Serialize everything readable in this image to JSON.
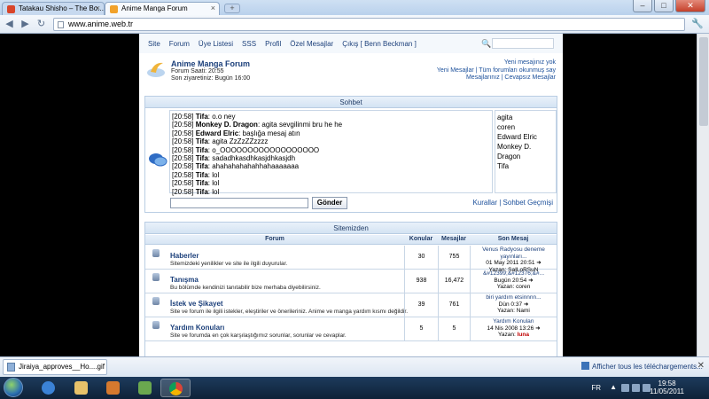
{
  "browser": {
    "tabs": [
      {
        "label": "Tatakau Shisho – The Bo..."
      },
      {
        "label": "Anime Manga Forum"
      }
    ],
    "url": "www.anime.web.tr"
  },
  "nav": {
    "items": [
      "Site",
      "Forum",
      "Üye Listesi",
      "SSS",
      "Profil",
      "Özel Mesajlar",
      "Çıkış [ Benn Beckman ]"
    ]
  },
  "header": {
    "site_name": "Anime Manga Forum",
    "time": "Forum Saati: 20:55",
    "last_visit": "Son ziyaretiniz: Bugün 16:00",
    "right_line1": "Yeni mesajınız yok",
    "right_line2": "Yeni Mesajlar | Tüm forumları okunmuş say",
    "right_line3": "Mesajlarınız | Cevapsız Mesajlar"
  },
  "chat": {
    "title": "Sohbet",
    "messages": [
      {
        "time": "[20:58]",
        "user": "Tifa",
        "text": ": o.o ney"
      },
      {
        "time": "[20:58]",
        "user": "Monkey D. Dragon",
        "text": ": agita sevgilinmi bru he he"
      },
      {
        "time": "[20:58]",
        "user": "Edward Elric",
        "text": ": başlığa mesaj atın"
      },
      {
        "time": "[20:58]",
        "user": "Tifa",
        "text": ": agita ZzZzZZzzzz"
      },
      {
        "time": "[20:58]",
        "user": "Tifa",
        "text": ": o_OOOOOOOOOOOOOOOOOO"
      },
      {
        "time": "[20:58]",
        "user": "Tifa",
        "text": ": sadadhkasdhkasjdhkasjdh"
      },
      {
        "time": "[20:58]",
        "user": "Tifa",
        "text": ": ahahahahahahhahaaaaaaa"
      },
      {
        "time": "[20:58]",
        "user": "Tifa",
        "text": ": lol"
      },
      {
        "time": "[20:58]",
        "user": "Tifa",
        "text": ": lol"
      },
      {
        "time": "[20:58]",
        "user": "Tifa",
        "text": ": lol"
      }
    ],
    "users": [
      "agita",
      "coren",
      "Edward Elric",
      "Monkey D. Dragon",
      "Tifa"
    ],
    "send_label": "Gönder",
    "links": "Kurallar | Sohbet Geçmişi"
  },
  "forums": {
    "title": "Sitemizden",
    "columns": {
      "forum": "Forum",
      "topics": "Konular",
      "posts": "Mesajlar",
      "last": "Son Mesaj"
    },
    "rows": [
      {
        "name": "Haberler",
        "desc": "Sitemizdeki yenilikler ve site ile ilgili duyurular.",
        "topics": "30",
        "posts": "755",
        "last_title": "Venus Radyosu deneme yayınları...",
        "last_date": "01 May 2011 20:51",
        "last_author_label": "Yazan:",
        "last_author": "SaILoRSuN"
      },
      {
        "name": "Tanışma",
        "desc": "Bu bölümde kendinizi tanıtabilir bize merhaba diyebilirsiniz.",
        "topics": "938",
        "posts": "16,472",
        "last_title": "&#12399;&#12376;&#...",
        "last_date": "Bugün 20:54",
        "last_author_label": "Yazan:",
        "last_author": "coren"
      },
      {
        "name": "İstek ve Şikayet",
        "desc": "Site ve forum ile ilgili istekler, eleştiriler ve önerileriniz. Anime ve manga yardım kısmı değildir.",
        "topics": "39",
        "posts": "761",
        "last_title": "biri yardım etsinnnn...",
        "last_date": "Dün 0:37",
        "last_author_label": "Yazan:",
        "last_author": "Nami"
      },
      {
        "name": "Yardım Konuları",
        "desc": "Site ve forumda en çok karşılaştığımız sorunlar, sorunlar ve cevaplar.",
        "topics": "5",
        "posts": "5",
        "last_title": "Yardım Konuları",
        "last_date": "14 Nis 2008 13:26",
        "last_author_label": "Yazan:",
        "last_author": "luna"
      }
    ]
  },
  "downloads": {
    "file": "Jiraiya_approves__Ho....gif",
    "show_all": "Afficher tous les téléchargements..."
  },
  "taskbar": {
    "lang": "FR",
    "time": "19:58",
    "date": "11/05/2011"
  }
}
